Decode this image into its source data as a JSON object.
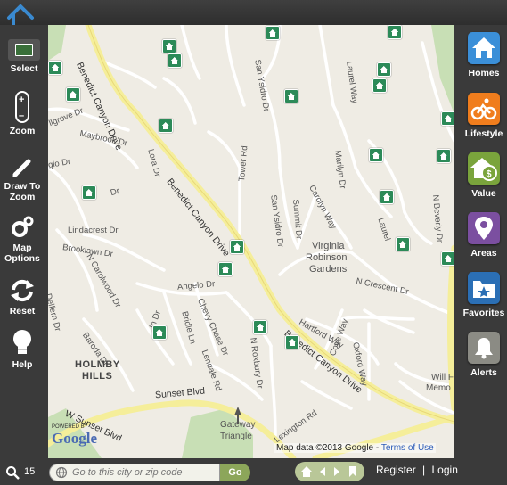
{
  "left_toolbar": [
    {
      "id": "select",
      "label": "Select",
      "icon": "cursor-select-icon"
    },
    {
      "id": "zoom",
      "label": "Zoom",
      "icon": "zoom-slider-icon"
    },
    {
      "id": "draw",
      "label": "Draw To Zoom",
      "label_lines": [
        "Draw To",
        "Zoom"
      ],
      "icon": "pencil-icon"
    },
    {
      "id": "map-options",
      "label": "Map Options",
      "label_lines": [
        "Map",
        "Options"
      ],
      "icon": "gears-icon"
    },
    {
      "id": "reset",
      "label": "Reset",
      "icon": "refresh-icon"
    },
    {
      "id": "help",
      "label": "Help",
      "icon": "lightbulb-icon"
    }
  ],
  "right_toolbar": [
    {
      "id": "homes",
      "label": "Homes",
      "icon": "house-icon",
      "color": "#3b8fd8"
    },
    {
      "id": "lifestyle",
      "label": "Lifestyle",
      "icon": "bicycle-icon",
      "color": "#f07d1d"
    },
    {
      "id": "value",
      "label": "Value",
      "icon": "house-dollar-icon",
      "color": "#7aa43c"
    },
    {
      "id": "areas",
      "label": "Areas",
      "icon": "map-pin-icon",
      "color": "#7b4fa0"
    },
    {
      "id": "favorites",
      "label": "Favorites",
      "icon": "folder-star-icon",
      "color": "#2b6fb5"
    },
    {
      "id": "alerts",
      "label": "Alerts",
      "icon": "bell-icon",
      "color": "#8b8b84"
    }
  ],
  "map": {
    "streets": {
      "benedict_upper": "Benedict Canyon Drive",
      "benedict_mid": "Benedict Canyon Drive",
      "benedict_lower": "Benedict Canyon Drive",
      "sunset_blvd": "Sunset Blvd",
      "w_sunset_blvd": "W Sunset Blvd",
      "maybrook": "Maybrook Dr",
      "hillgrove": "llgrove Dr",
      "angelo": "Angelo Dr",
      "chevy_chase": "Chevy Chase Dr",
      "bridle": "Bridle Ln",
      "lexington": "Lexington Rd",
      "n_roxbury": "N Roxbury Dr",
      "hartford": "Hartford Way",
      "oxford": "Oxford Way",
      "n_crescent": "N Crescent Dr",
      "cove": "Cove Way",
      "carolyn": "Carolyn Way",
      "summit": "Summit Dr",
      "san_ysidro_upper": "San Ysidro Dr",
      "san_ysidro_lower": "San Ysidro Dr",
      "tower": "Tower Rd",
      "laurel": "Laurel",
      "marilyn": "Marilyn Dr",
      "n_beverly": "N Beverly Dr",
      "brooklawn": "Brooklawn Dr",
      "n_carolwood": "N Carolwood Dr",
      "delfern": "Delfern Dr",
      "baroda": "Baroda Dr",
      "lausanne": "a Dr",
      "lamont": "Dr",
      "laurel_way_top": "Laurel Way",
      "laurel_way_left": "Way",
      "lora": "Lora Dr",
      "glo": "glo Dr",
      "in": "In Dr",
      "carolwood_b": "Dr",
      "lindacrest": "Lindacrest Dr",
      "crest_b": "Dr",
      "lendale": "Lendale Rd"
    },
    "places": {
      "virginia_robinson_line1": "Virginia",
      "virginia_robinson_line2": "Robinson",
      "virginia_robinson_line3": "Gardens",
      "holmby_line1": "HOLMBY",
      "holmby_line2": "HILLS",
      "gateway_line1": "Gateway",
      "gateway_line2": "Triangle",
      "will_line1": "Will F",
      "will_line2": "Memo"
    },
    "attribution": "Map data ©2013  Google - ",
    "terms": "Terms of Use",
    "powered_by": "POWERED BY",
    "google": "Google"
  },
  "bottom": {
    "count": "15",
    "search_placeholder": "Go to this city or zip code",
    "go_label": "Go",
    "register": "Register",
    "separator": "|",
    "login": "Login"
  }
}
